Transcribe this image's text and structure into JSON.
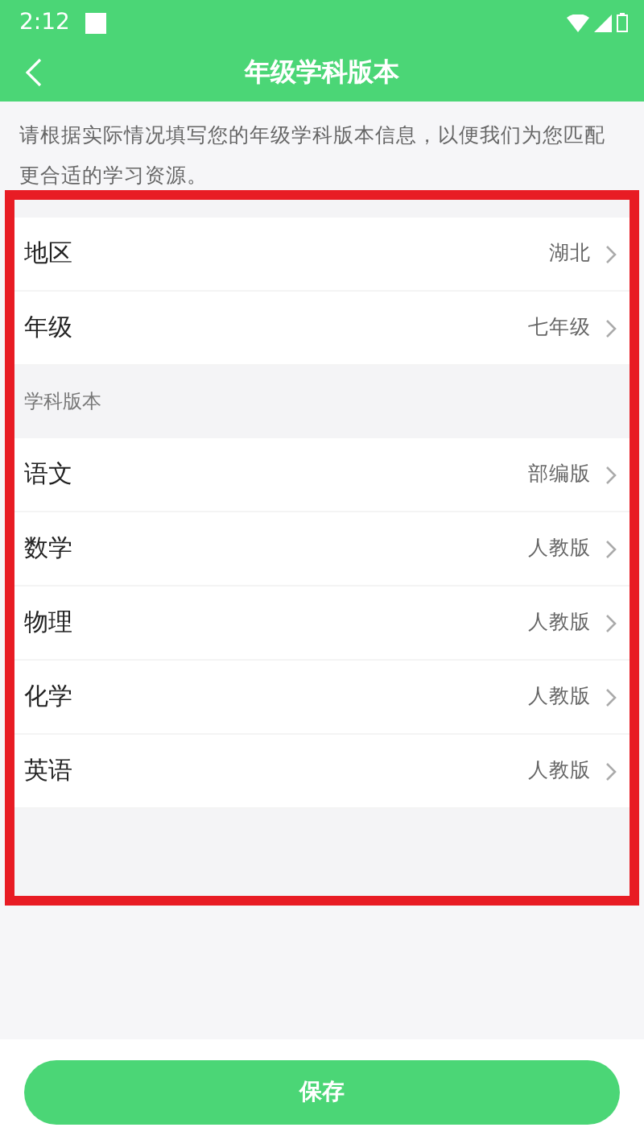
{
  "status_bar": {
    "time": "2:12"
  },
  "header": {
    "title": "年级学科版本"
  },
  "intro": "请根据实际情况填写您的年级学科版本信息，以便我们为您匹配更合适的学习资源。",
  "highlight_frame": {
    "shown": true
  },
  "basic_rows": [
    {
      "label": "地区",
      "value": "湖北"
    },
    {
      "label": "年级",
      "value": "七年级"
    }
  ],
  "section_label": "学科版本",
  "subject_rows": [
    {
      "label": "语文",
      "value": "部编版"
    },
    {
      "label": "数学",
      "value": "人教版"
    },
    {
      "label": "物理",
      "value": "人教版"
    },
    {
      "label": "化学",
      "value": "人教版"
    },
    {
      "label": "英语",
      "value": "人教版"
    }
  ],
  "save_button": "保存"
}
